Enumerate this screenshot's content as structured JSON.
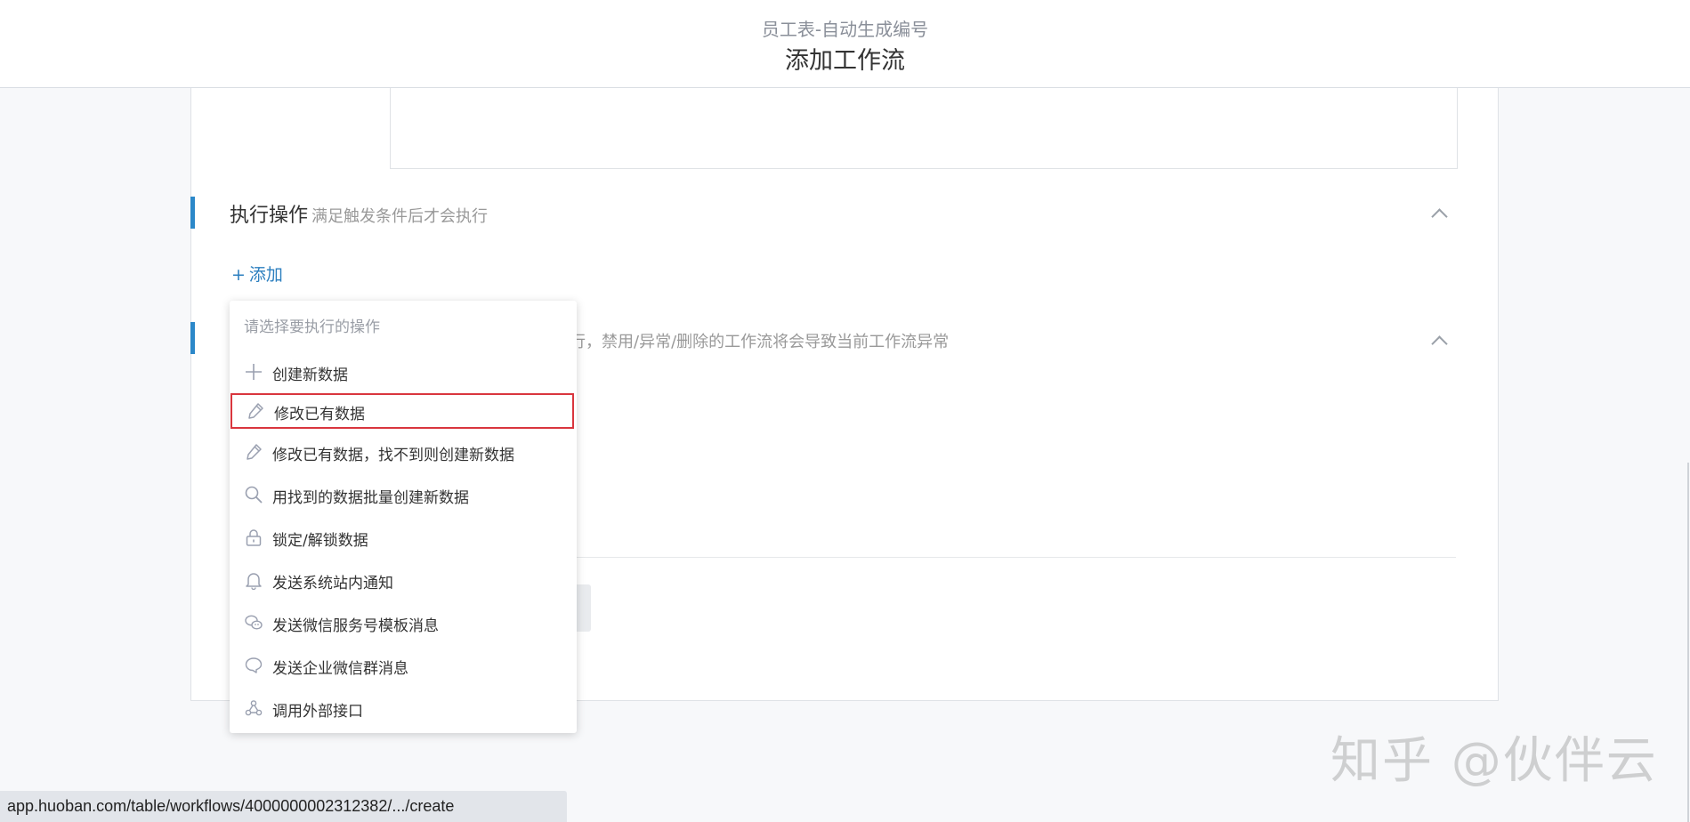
{
  "header": {
    "subtitle": "员工表-自动生成编号",
    "title": "添加工作流"
  },
  "actions_section": {
    "title": "执行操作",
    "description": "满足触发条件后才会执行",
    "add_label": "添加"
  },
  "second_section": {
    "description_partial": "行，禁用/异常/删除的工作流将会导致当前工作流异常"
  },
  "dropdown": {
    "placeholder": "请选择要执行的操作",
    "items": [
      {
        "label": "创建新数据",
        "icon": "plus-icon"
      },
      {
        "label": "修改已有数据",
        "icon": "pencil-icon",
        "selected": true
      },
      {
        "label": "修改已有数据，找不到则创建新数据",
        "icon": "pencil-icon"
      },
      {
        "label": "用找到的数据批量创建新数据",
        "icon": "search-icon"
      },
      {
        "label": "锁定/解锁数据",
        "icon": "lock-icon"
      },
      {
        "label": "发送系统站内通知",
        "icon": "bell-icon"
      },
      {
        "label": "发送微信服务号模板消息",
        "icon": "wechat-icon"
      },
      {
        "label": "发送企业微信群消息",
        "icon": "chat-bubble-icon"
      },
      {
        "label": "调用外部接口",
        "icon": "webhook-icon"
      }
    ]
  },
  "status_bar": {
    "url": "app.huoban.com/table/workflows/4000000002312382/.../create"
  },
  "watermark": "知乎 @伙伴云",
  "colors": {
    "accent": "#2c88c9",
    "link": "#2c7fbf",
    "selection_border": "#d9363e",
    "icon": "#9aa0b0"
  }
}
